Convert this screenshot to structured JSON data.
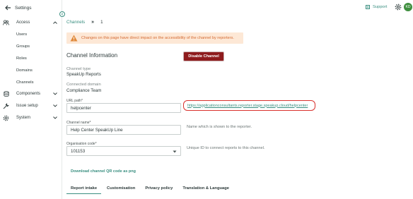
{
  "sidebar": {
    "title": "Settings",
    "items": [
      {
        "label": "Access",
        "icon": "users-icon"
      },
      {
        "label": "Users"
      },
      {
        "label": "Groups"
      },
      {
        "label": "Roles"
      },
      {
        "label": "Domains"
      },
      {
        "label": "Channels"
      },
      {
        "label": "Components",
        "icon": "database-icon"
      },
      {
        "label": "Issue setup",
        "icon": "wrench-icon"
      },
      {
        "label": "System",
        "icon": "gear-icon"
      }
    ]
  },
  "topbar": {
    "support_label": "Support",
    "avatar_initials": "KD"
  },
  "breadcrumb": {
    "parent": "Channels",
    "current": "1"
  },
  "warning": {
    "text": "Changes on this page have direct impact on the accessibility of the channel by reporters."
  },
  "channel_info": {
    "title": "Channel Information",
    "disable_button": "Disable Channel",
    "channel_type_label": "Channel type",
    "channel_type_value": "SpeakUp Reports",
    "connected_domain_label": "Connected domain",
    "connected_domain_value": "Compliance Team",
    "url_path_label": "URL path*",
    "url_path_value": "helpcenter",
    "url_link": "https://applicationconsultants.reporter.stage.speakup.cloud/helpcenter",
    "channel_name_label": "Channel name*",
    "channel_name_value": "Help Center SpeakUp Line",
    "channel_name_hint": "Name which is shown to the reporter.",
    "org_code_label": "Organisation code*",
    "org_code_value": "101153",
    "org_code_hint": "Unique ID to connect reports to this channel.",
    "qr_link": "Download channel QR code as png"
  },
  "tabs": [
    {
      "label": "Report intake",
      "active": true
    },
    {
      "label": "Customisation",
      "active": false
    },
    {
      "label": "Privacy policy",
      "active": false
    },
    {
      "label": "Translation & Language",
      "active": false
    }
  ],
  "colors": {
    "accent": "#3a8f80",
    "danger": "#8e1b1d",
    "warning_bg": "#fde8d6",
    "warning_text": "#d46a32",
    "highlight": "#d9322e"
  }
}
